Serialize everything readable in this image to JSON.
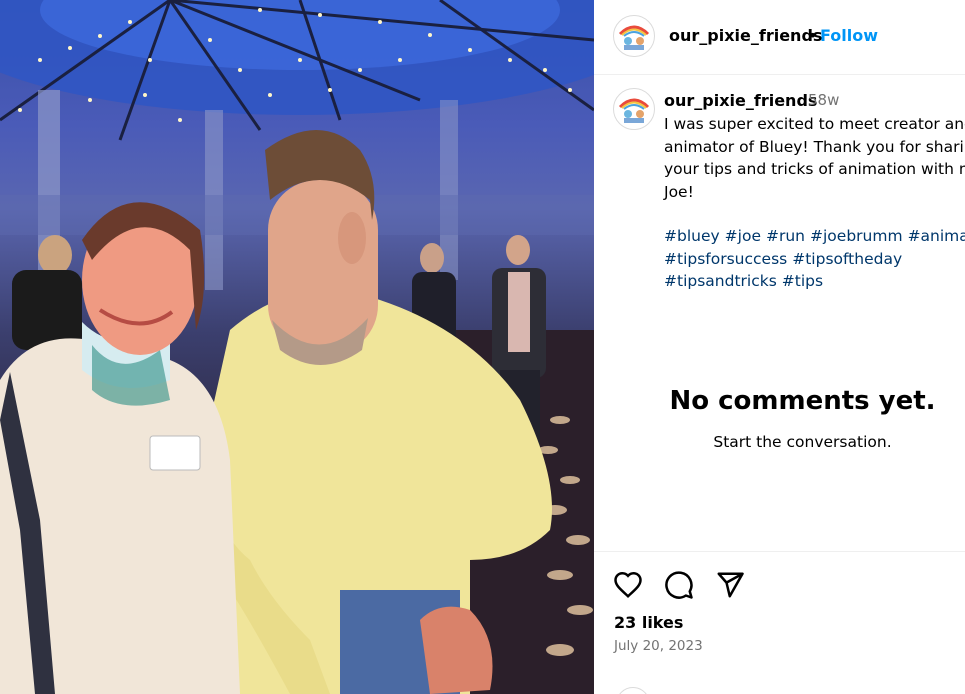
{
  "post": {
    "username": "our_pixie_friends",
    "follow_label": "Follow",
    "separator": "•",
    "time_ago": "58w",
    "caption": "I was super excited to meet creator and\nanimator of Bluey! Thank you for sharin\nyour tips and tricks of animation with m\nJoe!",
    "hashtags": [
      "#bluey",
      "#joe",
      "#run",
      "#joebrumm",
      "#animati",
      "#tipsforsuccess",
      "#tipsoftheday",
      "#tipsandtricks",
      "#tips"
    ]
  },
  "comments": {
    "empty_title": "No comments yet.",
    "empty_subtitle": "Start the conversation."
  },
  "actions": {
    "like_icon": "heart-icon",
    "comment_icon": "comment-icon",
    "share_icon": "share-icon",
    "likes_text": "23 likes",
    "date": "July 20, 2023"
  },
  "colors": {
    "link_blue": "#0095f6",
    "hashtag_blue": "#00376b",
    "muted_gray": "#737373",
    "divider": "#efefef"
  }
}
